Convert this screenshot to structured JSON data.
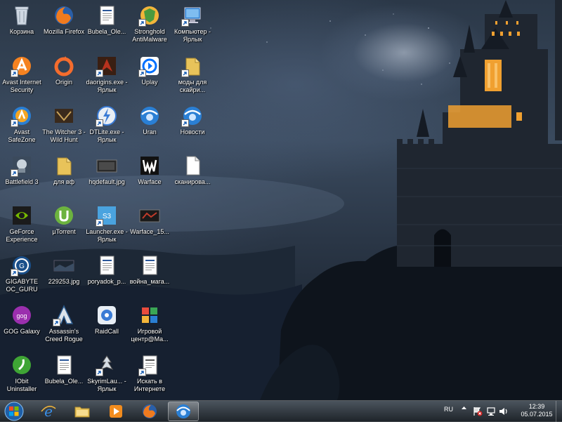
{
  "desktop": {
    "icons": [
      {
        "label": "Корзина",
        "icon": "recycle-bin-icon"
      },
      {
        "label": "Mozilla Firefox",
        "icon": "firefox-icon"
      },
      {
        "label": "Bubela_Ole...",
        "icon": "document-icon"
      },
      {
        "label": "Stronghold AntiMalware",
        "icon": "stronghold-icon"
      },
      {
        "label": "Компьютер - Ярлык",
        "icon": "computer-icon"
      },
      {
        "label": "Avast Internet Security",
        "icon": "avast-icon"
      },
      {
        "label": "Origin",
        "icon": "origin-icon"
      },
      {
        "label": "daorigins.exe - Ярлык",
        "icon": "dragon-age-icon"
      },
      {
        "label": "Uplay",
        "icon": "uplay-icon"
      },
      {
        "label": "моды для скайри...",
        "icon": "folder-shortcut-icon"
      },
      {
        "label": "Avast SafeZone",
        "icon": "avast-safezone-icon"
      },
      {
        "label": "The Witcher 3 - Wild Hunt",
        "icon": "witcher-icon"
      },
      {
        "label": "DTLite.exe - Ярлык",
        "icon": "daemon-tools-icon"
      },
      {
        "label": "Uran",
        "icon": "uran-browser-icon"
      },
      {
        "label": "Новости",
        "icon": "news-browser-icon"
      },
      {
        "label": "Battlefield 3",
        "icon": "battlefield-icon"
      },
      {
        "label": "для вф",
        "icon": "folder-icon"
      },
      {
        "label": "hqdefault.jpg",
        "icon": "image-icon"
      },
      {
        "label": "Warface",
        "icon": "warface-icon"
      },
      {
        "label": "сканирова...",
        "icon": "blank-file-icon"
      },
      {
        "label": "GeForce Experience",
        "icon": "geforce-icon"
      },
      {
        "label": "µTorrent",
        "icon": "utorrent-icon"
      },
      {
        "label": "Launcher.exe - Ярлык",
        "icon": "sims-launcher-icon"
      },
      {
        "label": "Warface_15...",
        "icon": "image-icon"
      },
      {
        "label": "GIGABYTE OC_GURU",
        "icon": "gigabyte-icon"
      },
      {
        "label": "229253.jpg",
        "icon": "image-icon"
      },
      {
        "label": "poryadok_p...",
        "icon": "document-icon"
      },
      {
        "label": "война_мага...",
        "icon": "document-icon"
      },
      {
        "label": "GOG Galaxy",
        "icon": "gog-icon"
      },
      {
        "label": "Assassin's Creed Rogue",
        "icon": "assassins-creed-icon"
      },
      {
        "label": "RaidCall",
        "icon": "raidcall-icon"
      },
      {
        "label": "Игровой центр@Ma...",
        "icon": "game-center-icon"
      },
      {
        "label": "IObit Uninstaller",
        "icon": "iobit-icon"
      },
      {
        "label": "Bubela_Ole...",
        "icon": "document-icon"
      },
      {
        "label": "SkyrimLau... - Ярлык",
        "icon": "skyrim-icon"
      },
      {
        "label": "Искать в Интернете",
        "icon": "search-web-icon"
      }
    ]
  },
  "taskbar": {
    "start_icon": "windows-start-icon",
    "pinned": [
      {
        "name": "internet-explorer",
        "icon": "internet-explorer-icon",
        "active": false
      },
      {
        "name": "file-explorer",
        "icon": "folder-explorer-icon",
        "active": false
      },
      {
        "name": "media-player",
        "icon": "media-player-icon",
        "active": false
      },
      {
        "name": "firefox",
        "icon": "firefox-icon",
        "active": false
      },
      {
        "name": "browser",
        "icon": "browser-icon",
        "active": true
      }
    ],
    "tray": {
      "language": "RU",
      "time": "12:39",
      "date": "05.07.2015"
    }
  },
  "colors": {
    "taskbar": "#1e262e",
    "label_text": "#ffffff",
    "castle_light": "#f0a030"
  }
}
